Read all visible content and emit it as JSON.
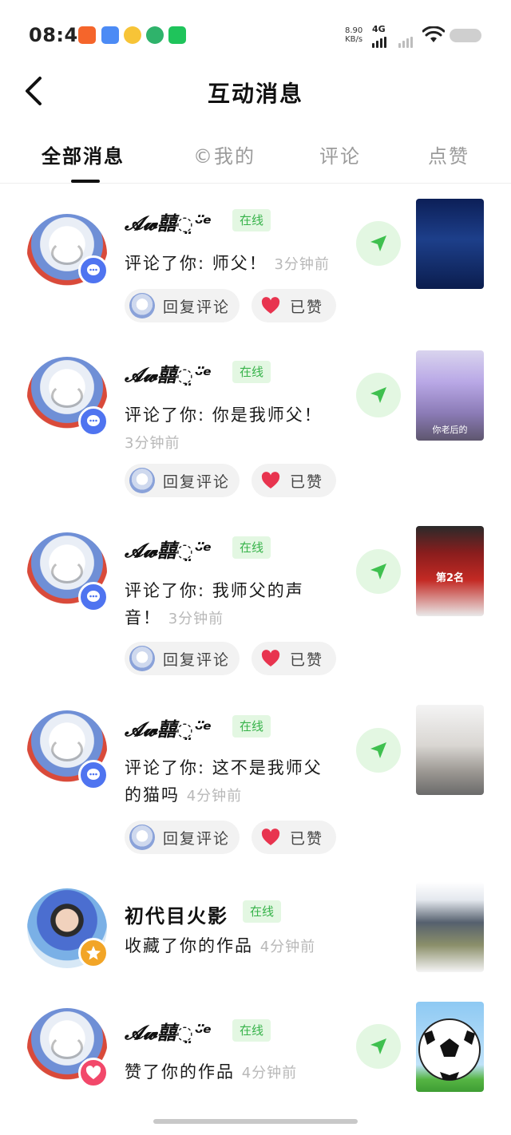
{
  "status_bar": {
    "time": "08:48",
    "speed_value": "8.90",
    "speed_unit": "KB/s",
    "network": "4G",
    "app_icons": [
      "app-icon",
      "app-icon",
      "app-icon",
      "app-icon",
      "wechat-icon"
    ]
  },
  "header": {
    "title": "互动消息"
  },
  "tabs": [
    {
      "label": "全部消息",
      "active": true
    },
    {
      "label": "©我的",
      "active": false
    },
    {
      "label": "评论",
      "active": false
    },
    {
      "label": "点赞",
      "active": false
    }
  ],
  "messages": [
    {
      "username": "𝓐𝔀囍◌̤ᵕ̈ᵉ",
      "status": "在线",
      "text": "评论了你: 师父！",
      "time": "3分钟前",
      "reply_label": "回复评论",
      "liked_label": "已赞",
      "badge": "comment-icon",
      "thumbnail_text": ""
    },
    {
      "username": "𝓐𝔀囍◌̤ᵕ̈ᵉ",
      "status": "在线",
      "text": "评论了你: 你是我师父！",
      "time": "3分钟前",
      "reply_label": "回复评论",
      "liked_label": "已赞",
      "badge": "comment-icon",
      "thumbnail_text": "你老后的"
    },
    {
      "username": "𝓐𝔀囍◌̤ᵕ̈ᵉ",
      "status": "在线",
      "text": "评论了你: 我师父的声音！",
      "time": "3分钟前",
      "reply_label": "回复评论",
      "liked_label": "已赞",
      "badge": "comment-icon",
      "thumbnail_text": "第2名"
    },
    {
      "username": "𝓐𝔀囍◌̤ᵕ̈ᵉ",
      "status": "在线",
      "text": "评论了你: 这不是我师父的猫吗",
      "time": "4分钟前",
      "reply_label": "回复评论",
      "liked_label": "已赞",
      "badge": "comment-icon",
      "thumbnail_text": ""
    },
    {
      "username": "初代目火影",
      "status": "在线",
      "text": "收藏了你的作品",
      "time": "4分钟前",
      "badge": "star-icon",
      "thumbnail_text": ""
    },
    {
      "username": "𝓐𝔀囍◌̤ᵕ̈ᵉ",
      "status": "在线",
      "text": "赞了你的作品",
      "time": "4分钟前",
      "badge": "heart-icon",
      "thumbnail_text": ""
    }
  ],
  "colors": {
    "online_bg": "#e3f7e2",
    "online_text": "#37b34a",
    "comment_badge": "#4f74f0",
    "star_badge": "#f2a527",
    "heart_badge": "#f2486a",
    "like_heart": "#e8344f"
  }
}
